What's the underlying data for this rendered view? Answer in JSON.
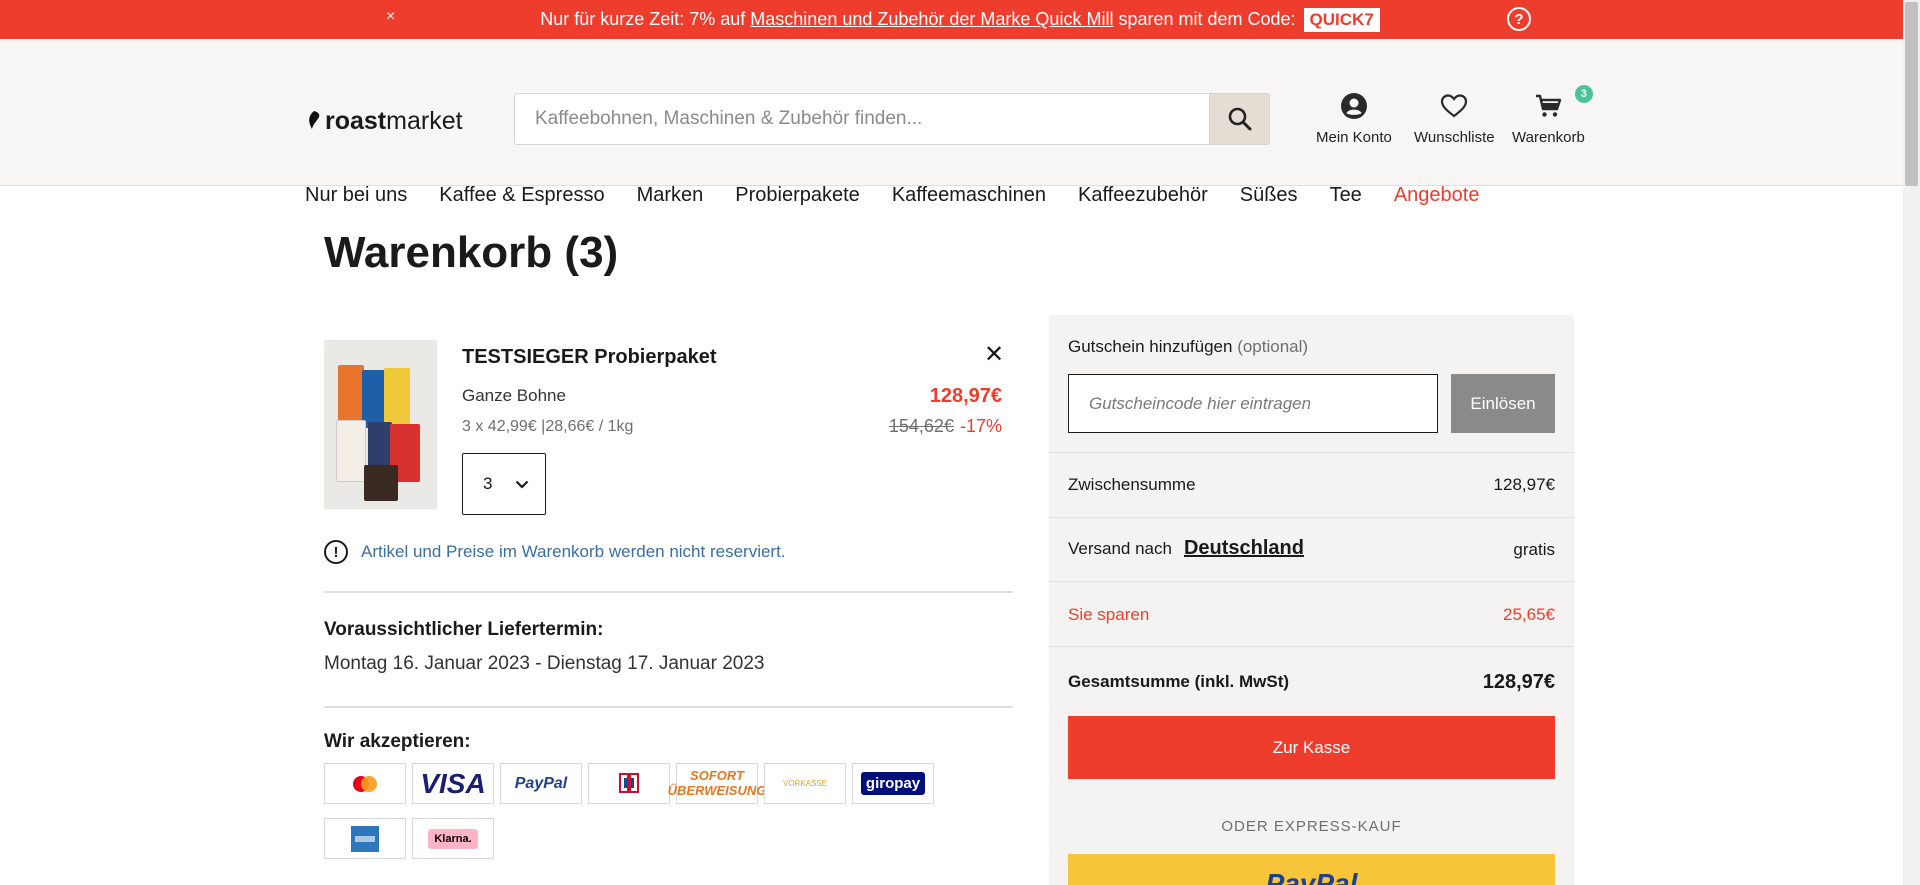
{
  "promo": {
    "text_before": "Nur für kurze Zeit: 7% auf ",
    "link": "Maschinen und Zubehör der Marke Quick Mill",
    "text_after": " sparen mit dem Code:",
    "code": "QUICK7",
    "close": "×",
    "help": "?"
  },
  "header": {
    "logo_roast": "roast",
    "logo_market": "market",
    "search_placeholder": "Kaffeebohnen, Maschinen & Zubehör finden...",
    "account": "Mein Konto",
    "wishlist": "Wunschliste",
    "cart": "Warenkorb",
    "cart_count": "3"
  },
  "nav": {
    "items": [
      "Nur bei uns",
      "Kaffee & Espresso",
      "Marken",
      "Probierpakete",
      "Kaffeemaschinen",
      "Kaffeezubehör",
      "Süßes",
      "Tee",
      "Angebote"
    ]
  },
  "page": {
    "title": "Warenkorb (3)"
  },
  "item": {
    "name": "TESTSIEGER Probierpaket",
    "variant": "Ganze Bohne",
    "unit": "3 x 42,99€ |28,66€ / 1kg",
    "price_now": "128,97€",
    "price_old": "154,62€",
    "discount": "-17%",
    "quantity": "3",
    "remove": "✕"
  },
  "notice": {
    "icon": "!",
    "text": "Artikel und Preise im Warenkorb werden nicht reserviert."
  },
  "delivery": {
    "heading": "Voraussichtlicher Liefertermin:",
    "value": "Montag 16. Januar 2023 - Dienstag 17. Januar 2023"
  },
  "payments": {
    "heading": "Wir akzeptieren:",
    "methods": [
      "mastercard",
      "VISA",
      "PayPal",
      "girocard",
      "SOFORT ÜBERWEISUNG",
      "VORKASSE",
      "giropay",
      "American Express",
      "Klarna."
    ]
  },
  "summary": {
    "voucher_label": "Gutschein hinzufügen",
    "voucher_optional": "(optional)",
    "voucher_placeholder": "Gutscheincode hier eintragen",
    "redeem": "Einlösen",
    "subtotal_label": "Zwischensumme",
    "subtotal_value": "128,97€",
    "shipping_label": "Versand nach",
    "shipping_country": "Deutschland",
    "shipping_value": "gratis",
    "savings_label": "Sie sparen",
    "savings_value": "25,65€",
    "total_label": "Gesamtsumme (inkl. MwSt)",
    "total_value": "128,97€",
    "checkout": "Zur Kasse",
    "express": "ODER EXPRESS-KAUF",
    "paypal": "PayPal"
  },
  "colors": {
    "accent": "#ee3d2c",
    "badge": "#4cc49a",
    "link_blue": "#3a6ea5",
    "paypal_yellow": "#f8c43a"
  }
}
